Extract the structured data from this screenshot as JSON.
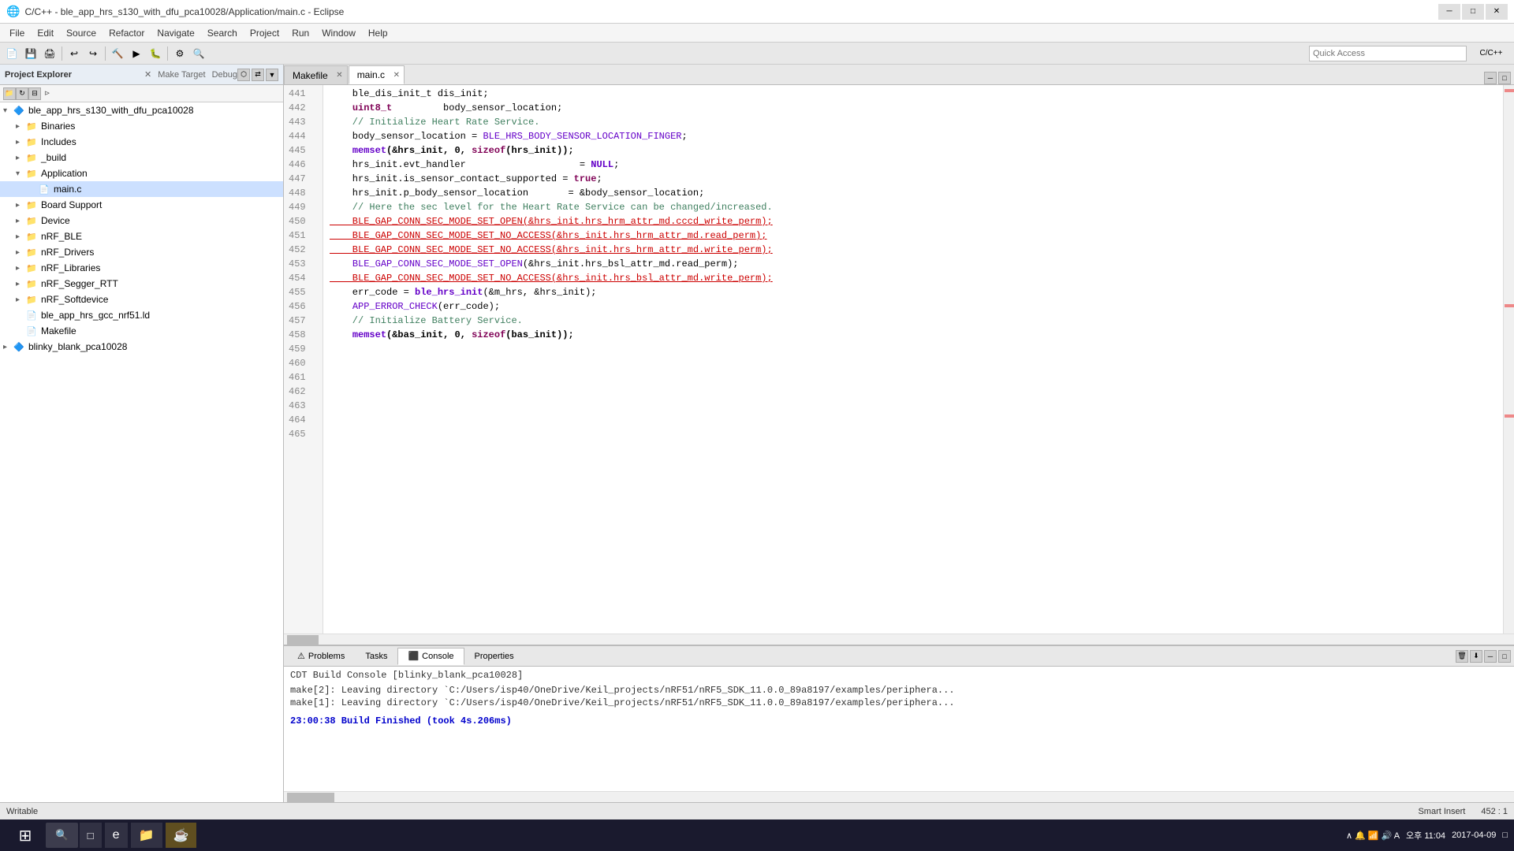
{
  "titlebar": {
    "title": "C/C++ - ble_app_hrs_s130_with_dfu_pca10028/Application/main.c - Eclipse",
    "icon": "🌐"
  },
  "menubar": {
    "items": [
      "File",
      "Edit",
      "Source",
      "Refactor",
      "Navigate",
      "Search",
      "Project",
      "Run",
      "Window",
      "Help"
    ]
  },
  "toolbar": {
    "quick_access_placeholder": "Quick Access"
  },
  "left_panel": {
    "title": "Project Explorer",
    "secondary_tabs": [
      "Make Target",
      "Debug"
    ],
    "tree": [
      {
        "id": "root",
        "label": "ble_app_hrs_s130_with_dfu_pca10028",
        "level": 0,
        "expanded": true,
        "type": "project"
      },
      {
        "id": "binaries",
        "label": "Binaries",
        "level": 1,
        "expanded": false,
        "type": "folder"
      },
      {
        "id": "includes",
        "label": "Includes",
        "level": 1,
        "expanded": false,
        "type": "folder"
      },
      {
        "id": "build",
        "label": "_build",
        "level": 1,
        "expanded": false,
        "type": "folder"
      },
      {
        "id": "application",
        "label": "Application",
        "level": 1,
        "expanded": true,
        "type": "folder-red"
      },
      {
        "id": "mainc",
        "label": "main.c",
        "level": 2,
        "expanded": false,
        "type": "file-c"
      },
      {
        "id": "board_support",
        "label": "Board Support",
        "level": 1,
        "expanded": false,
        "type": "folder-red"
      },
      {
        "id": "device",
        "label": "Device",
        "level": 1,
        "expanded": false,
        "type": "folder-red"
      },
      {
        "id": "nrf_ble",
        "label": "nRF_BLE",
        "level": 1,
        "expanded": false,
        "type": "folder-red"
      },
      {
        "id": "nrf_drivers",
        "label": "nRF_Drivers",
        "level": 1,
        "expanded": false,
        "type": "folder-red"
      },
      {
        "id": "nrf_libraries",
        "label": "nRF_Libraries",
        "level": 1,
        "expanded": false,
        "type": "folder-red"
      },
      {
        "id": "nrf_segger",
        "label": "nRF_Segger_RTT",
        "level": 1,
        "expanded": false,
        "type": "folder-red"
      },
      {
        "id": "nrf_softdevice",
        "label": "nRF_Softdevice",
        "level": 1,
        "expanded": false,
        "type": "folder-red"
      },
      {
        "id": "linker",
        "label": "ble_app_hrs_gcc_nrf51.ld",
        "level": 1,
        "expanded": false,
        "type": "file"
      },
      {
        "id": "makefile_item",
        "label": "Makefile",
        "level": 1,
        "expanded": false,
        "type": "file"
      },
      {
        "id": "blinky",
        "label": "blinky_blank_pca10028",
        "level": 0,
        "expanded": false,
        "type": "project"
      }
    ]
  },
  "editor": {
    "tabs": [
      {
        "label": "Makefile",
        "active": false
      },
      {
        "label": "main.c",
        "active": true
      }
    ],
    "lines": [
      {
        "num": 441,
        "code": "    ble_dis_init_t dis_init;",
        "type": "normal"
      },
      {
        "num": 442,
        "code": "    uint8_t         body_sensor_location;",
        "type": "normal"
      },
      {
        "num": 443,
        "code": "",
        "type": "normal"
      },
      {
        "num": 444,
        "code": "    // Initialize Heart Rate Service.",
        "type": "comment"
      },
      {
        "num": 445,
        "code": "    body_sensor_location = BLE_HRS_BODY_SENSOR_LOCATION_FINGER;",
        "type": "normal"
      },
      {
        "num": 446,
        "code": "",
        "type": "normal"
      },
      {
        "num": 447,
        "code": "    memset(&hrs_init, 0, sizeof(hrs_init));",
        "type": "bold"
      },
      {
        "num": 448,
        "code": "",
        "type": "normal"
      },
      {
        "num": 449,
        "code": "    hrs_init.evt_handler                    = NULL;",
        "type": "evt"
      },
      {
        "num": 450,
        "code": "    hrs_init.is_sensor_contact_supported = true;",
        "type": "contact"
      },
      {
        "num": 451,
        "code": "    hrs_init.p_body_sensor_location       = &body_sensor_location;",
        "type": "sensor"
      },
      {
        "num": 452,
        "code": "",
        "type": "highlight"
      },
      {
        "num": 453,
        "code": "    // Here the sec level for the Heart Rate Service can be changed/increased.",
        "type": "comment"
      },
      {
        "num": 454,
        "code": "    BLE_GAP_CONN_SEC_MODE_SET_OPEN(&hrs_init.hrs_hrm_attr_md.cccd_write_perm);",
        "type": "error"
      },
      {
        "num": 455,
        "code": "    BLE_GAP_CONN_SEC_MODE_SET_NO_ACCESS(&hrs_init.hrs_hrm_attr_md.read_perm);",
        "type": "error"
      },
      {
        "num": 456,
        "code": "    BLE_GAP_CONN_SEC_MODE_SET_NO_ACCESS(&hrs_init.hrs_hrm_attr_md.write_perm);",
        "type": "error"
      },
      {
        "num": 457,
        "code": "",
        "type": "normal"
      },
      {
        "num": 458,
        "code": "    BLE_GAP_CONN_SEC_MODE_SET_OPEN(&hrs_init.hrs_bsl_attr_md.read_perm);",
        "type": "normal"
      },
      {
        "num": 459,
        "code": "    BLE_GAP_CONN_SEC_MODE_SET_NO_ACCESS(&hrs_init.hrs_bsl_attr_md.write_perm);",
        "type": "error"
      },
      {
        "num": 460,
        "code": "",
        "type": "normal"
      },
      {
        "num": 461,
        "code": "    err_code = ble_hrs_init(&m_hrs, &hrs_init);",
        "type": "normal"
      },
      {
        "num": 462,
        "code": "    APP_ERROR_CHECK(err_code);",
        "type": "normal"
      },
      {
        "num": 463,
        "code": "",
        "type": "normal"
      },
      {
        "num": 464,
        "code": "    // Initialize Battery Service.",
        "type": "comment"
      },
      {
        "num": 465,
        "code": "    memset(&bas_init, 0, sizeof(bas_init));",
        "type": "bold"
      }
    ]
  },
  "console": {
    "title": "CDT Build Console [blinky_blank_pca10028]",
    "lines": [
      "make[2]: Leaving directory `C:/Users/isp40/OneDrive/Keil_projects/nRF51/nRF5_SDK_11.0.0_89a8197/examples/periphera...",
      "make[1]: Leaving directory `C:/Users/isp40/OneDrive/Keil_projects/nRF51/nRF5_SDK_11.0.0_89a8197/examples/periphera..."
    ],
    "build_finished": "23:00:38 Build Finished (took 4s.206ms)"
  },
  "bottom_tabs": [
    "Problems",
    "Tasks",
    "Console",
    "Properties"
  ],
  "status_bar": {
    "writable": "Writable",
    "insert_mode": "Smart Insert",
    "position": "452 : 1"
  },
  "taskbar": {
    "time": "오후 11:04",
    "date": "2017-04-09",
    "apps": [
      "⊞",
      "□",
      "e",
      "📁",
      "☕"
    ]
  }
}
